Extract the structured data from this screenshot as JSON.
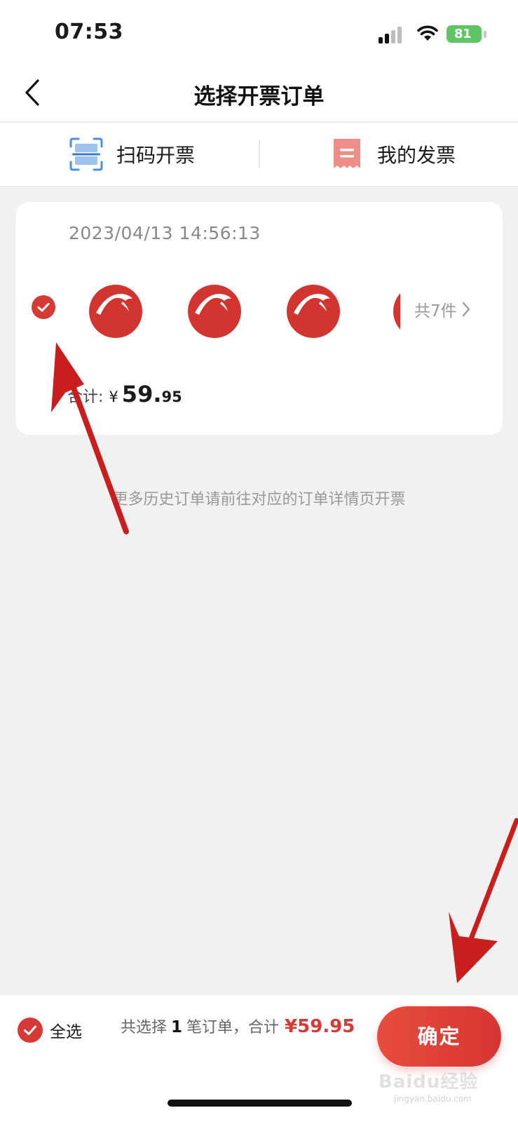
{
  "status_bar": {
    "time": "07:53",
    "battery": "81"
  },
  "nav": {
    "title": "选择开票订单"
  },
  "tools": [
    {
      "label": "扫码开票",
      "icon": "scan-icon"
    },
    {
      "label": "我的发票",
      "icon": "invoice-icon"
    }
  ],
  "order": {
    "date": "2023/04/13 14:56:13",
    "items_count": "共7件",
    "total_label": "合计:",
    "currency": "¥",
    "total_int": "59.",
    "total_dec": "95",
    "selected": true
  },
  "hint": "更多历史订单请前往对应的订单详情页开票",
  "bottom": {
    "select_all_label": "全选",
    "summary_prefix": "共选择",
    "summary_count": "1",
    "summary_suffix": "笔订单，合计",
    "summary_amount": "¥59.95",
    "confirm_label": "确定"
  },
  "watermark": {
    "brand": "Baidu经验",
    "url": "jingyan.baidu.com"
  },
  "colors": {
    "accent": "#d63a35",
    "background": "#f1f1f1",
    "scan_blue": "#4a8fe0"
  }
}
